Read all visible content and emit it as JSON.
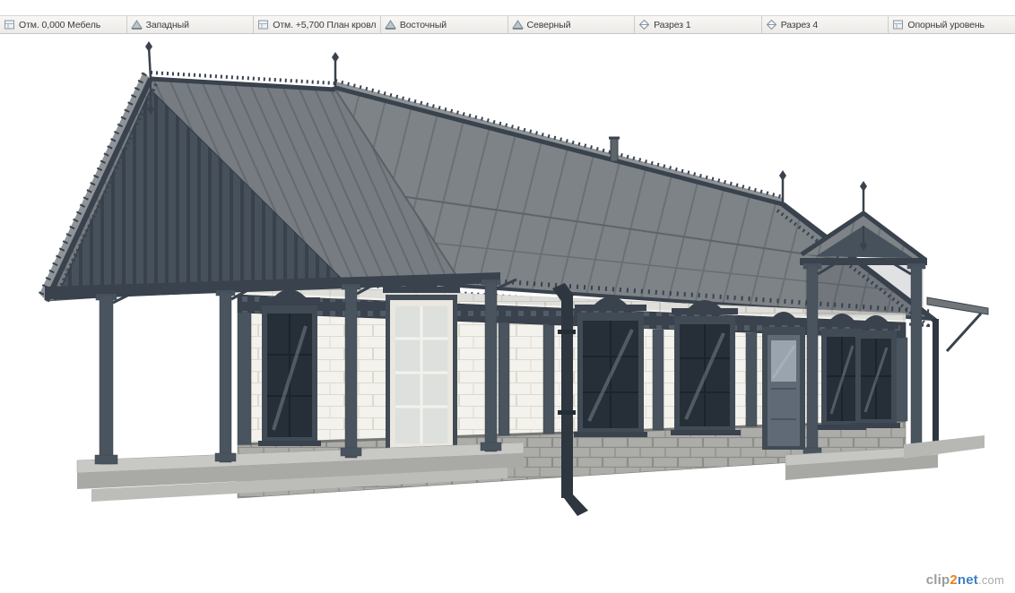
{
  "view_tabs": [
    {
      "label": "Отм. 0,000 Мебель",
      "type": "plan"
    },
    {
      "label": "Западный",
      "type": "elevation"
    },
    {
      "label": "Отм. +5,700 План кровли",
      "type": "plan"
    },
    {
      "label": "Восточный",
      "type": "elevation"
    },
    {
      "label": "Северный",
      "type": "elevation"
    },
    {
      "label": "Разрез 1",
      "type": "section"
    },
    {
      "label": "Разрез 4",
      "type": "section"
    },
    {
      "label": "Опорный уровень",
      "type": "plan"
    }
  ],
  "watermark": {
    "clip": "clip",
    "two": "2",
    "net": "net",
    "dotcom": ".com"
  },
  "colors": {
    "trim_dark": "#39424d",
    "roof_gray": "#7e8388",
    "wall_white": "#f3f2ec",
    "stone_gray": "#acaca8",
    "watermark_orange": "#f07f1e",
    "watermark_blue": "#3f80c4",
    "watermark_gray": "#9b9b9b"
  }
}
